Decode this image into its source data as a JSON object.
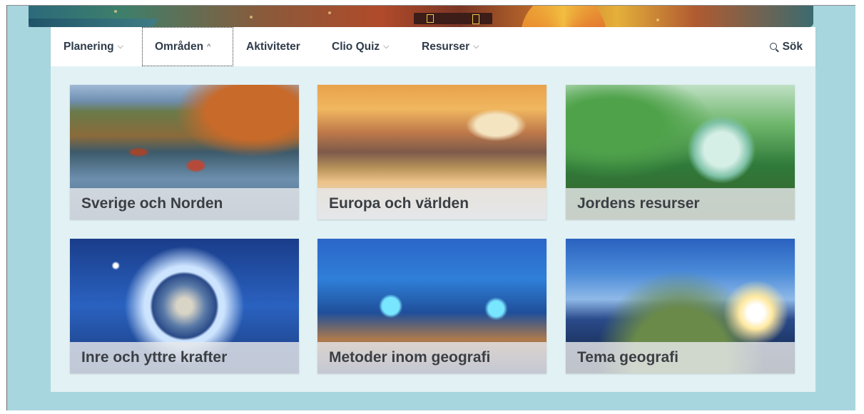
{
  "nav": {
    "items": [
      {
        "label": "Planering",
        "chevron": "⌵"
      },
      {
        "label": "Områden",
        "chevron": "^"
      },
      {
        "label": "Aktiviteter",
        "chevron": ""
      },
      {
        "label": "Clio Quiz",
        "chevron": "⌵"
      },
      {
        "label": "Resurser",
        "chevron": "⌵"
      }
    ],
    "active_item": "Områden",
    "search_label": "Sök"
  },
  "cards": [
    {
      "title": "Sverige och Norden",
      "image": "coastal-village-photo"
    },
    {
      "title": "Europa och världen",
      "image": "rome-bridge-photo"
    },
    {
      "title": "Jordens resurser",
      "image": "glass-globe-forest-photo"
    },
    {
      "title": "Inre och yttre krafter",
      "image": "earth-in-space-photo"
    },
    {
      "title": "Metoder inom geografi",
      "image": "smart-city-network-photo"
    },
    {
      "title": "Tema geografi",
      "image": "earth-horizon-sunrise-photo"
    }
  ],
  "colors": {
    "page_bg": "#a8d6df",
    "content_bg": "#e2f1f4",
    "nav_text": "#2f3b4a",
    "caption_bg": "#e6e8ea"
  }
}
